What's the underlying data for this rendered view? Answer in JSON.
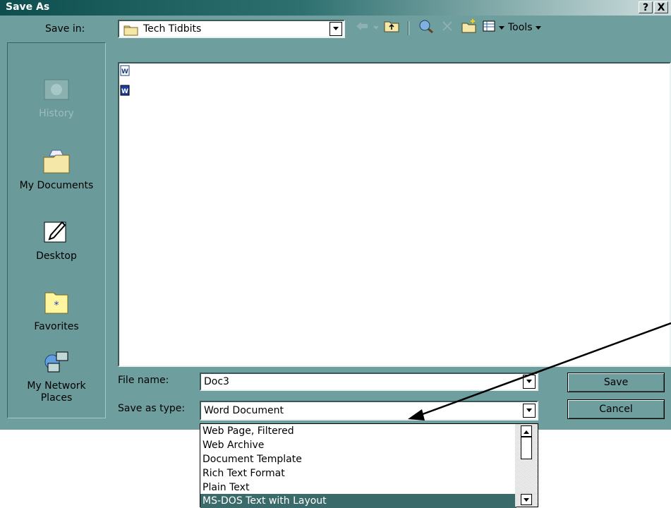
{
  "window": {
    "title": "Save As",
    "help_label": "?",
    "close_label": "X"
  },
  "toolbar": {
    "save_in_label": "Save in:",
    "save_in_value": "Tech Tidbits",
    "tools_label": "Tools"
  },
  "places": [
    {
      "label": "History"
    },
    {
      "label": "My Documents"
    },
    {
      "label": "Desktop"
    },
    {
      "label": "Favorites"
    },
    {
      "label": "My Network Places"
    }
  ],
  "files": [
    {
      "name": "",
      "icon": "word-document-icon"
    },
    {
      "name": "",
      "icon": "word-document-icon"
    }
  ],
  "form": {
    "file_name_label": "File name:",
    "file_name_value": "Doc3",
    "save_type_label": "Save as type:",
    "save_type_value": "Word Document",
    "save_button": "Save",
    "cancel_button": "Cancel"
  },
  "type_options": [
    "Web Page, Filtered",
    "Web Archive",
    "Document Template",
    "Rich Text Format",
    "Plain Text",
    "MS-DOS Text with Layout"
  ],
  "selected_option": "MS-DOS Text with Layout",
  "colors": {
    "dialog_bg": "#6e9e9e",
    "title_start": "#0e4e4e",
    "selection": "#3a6a6a"
  }
}
